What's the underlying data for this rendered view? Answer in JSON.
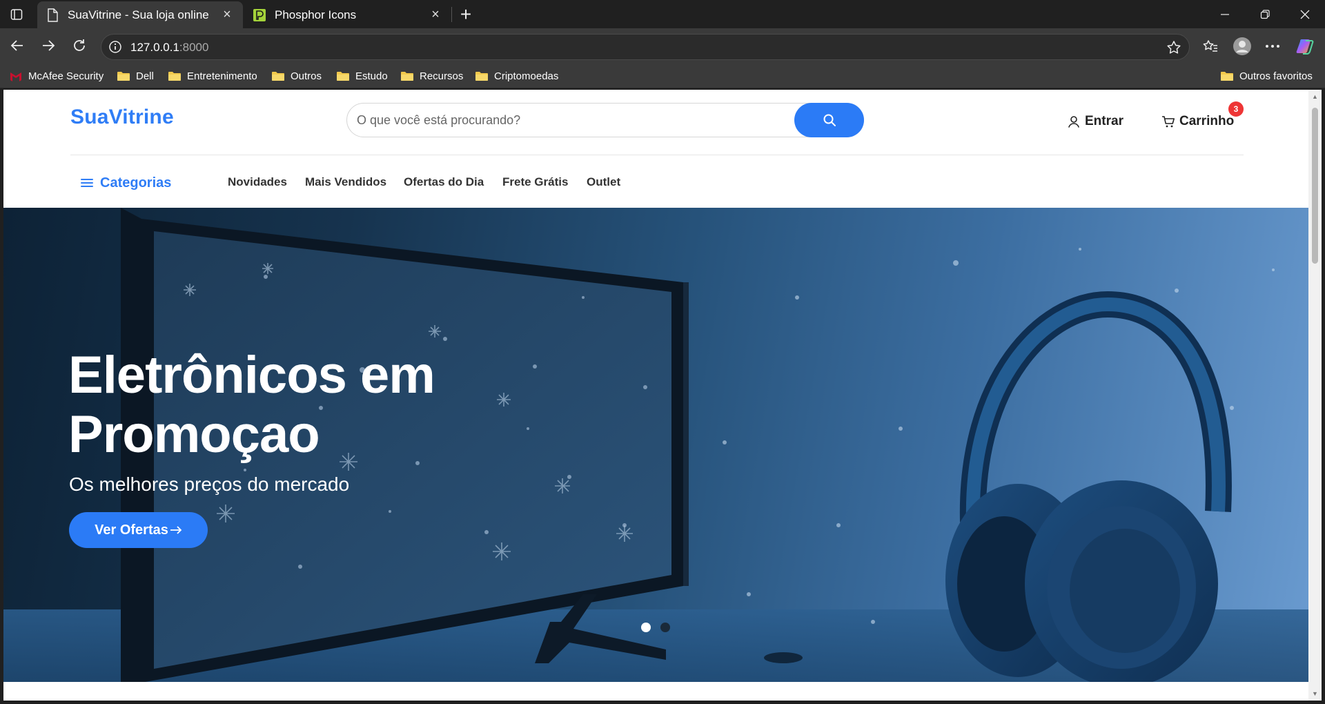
{
  "browser": {
    "tabs": [
      {
        "title": "SuaVitrine - Sua loja online",
        "active": true
      },
      {
        "title": "Phosphor Icons",
        "active": false
      }
    ],
    "url": {
      "host": "127.0.0.1",
      "port": ":8000"
    },
    "bookmarks": [
      {
        "label": "McAfee Security",
        "icon": "mcafee-icon"
      },
      {
        "label": "Dell",
        "icon": "folder-icon"
      },
      {
        "label": "Entretenimento",
        "icon": "folder-icon"
      },
      {
        "label": "Outros",
        "icon": "folder-icon"
      },
      {
        "label": "Estudo",
        "icon": "folder-icon"
      },
      {
        "label": "Recursos",
        "icon": "folder-icon"
      },
      {
        "label": "Criptomoedas",
        "icon": "folder-icon"
      }
    ],
    "other_bookmarks": "Outros favoritos"
  },
  "site": {
    "logo": "SuaVitrine",
    "search_placeholder": "O que você está procurando?",
    "login_label": "Entrar",
    "cart_label": "Carrinho",
    "cart_count": "3",
    "categories_label": "Categorias",
    "nav": [
      "Novidades",
      "Mais Vendidos",
      "Ofertas do Dia",
      "Frete Grátis",
      "Outlet"
    ]
  },
  "hero": {
    "title_line1": "Eletrônicos em",
    "title_line2": "Promoçao",
    "subtitle": "Os melhores preços do mercado",
    "cta": "Ver Ofertas",
    "slides_total": 2,
    "slide_active": 1
  },
  "colors": {
    "brand": "#2f7df6",
    "button": "#2b7bf6",
    "badge": "#ee3535"
  }
}
